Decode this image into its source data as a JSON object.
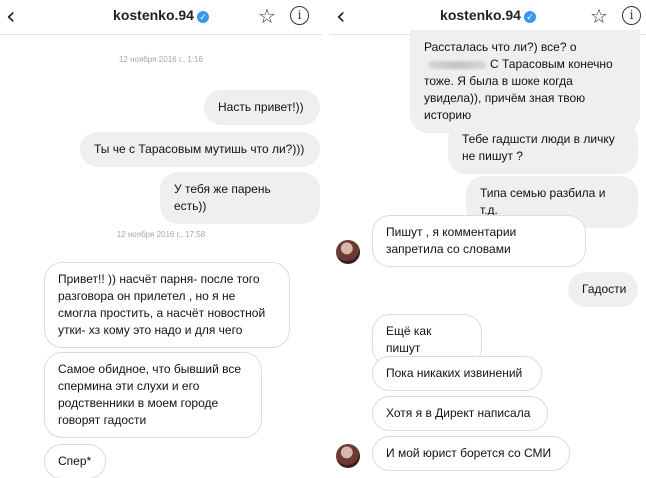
{
  "username": "kostenko.94",
  "icons": {
    "back": "chevron-left-icon",
    "verified": "verified-badge-icon",
    "star": "star-icon",
    "info": "info-icon"
  },
  "colors": {
    "verified": "#3897f0",
    "outgoing_bubble": "#efefef",
    "incoming_border": "#dcdcdc"
  },
  "left": {
    "ts1": "12 ноября 2016 г., 1:16",
    "m1": "Насть привет!))",
    "m2": "Ты че с Тарасовым мутишь что ли?)))",
    "m3": "У тебя же парень есть))",
    "ts2": "12 ноября 2016 г., 17:58",
    "r1": "Привет!! )) насчёт парня- после того разговора он прилетел , но я не смогла простить, а насчёт новостной утки- хз кому это надо и для чего",
    "r2": "Самое обидное, что бывший все спермина эти слухи и его родственники в моем городе говорят гадости",
    "r3": "Спер*"
  },
  "right": {
    "m0a": "Рассталась что ли?) все? о",
    "m0b": "С Тарасовым конечно тоже. Я была в шоке когда увидела)), причём зная твою историю",
    "m1": "Тебе гадшсти люди в личку не пишут ?",
    "m2": "Типа семью разбила и т.д.",
    "r1": "Пишут , я комментарии запретила со словами",
    "m3": "Гадости",
    "r2": "Ещё как пишут",
    "r3": "Пока никаких извинений",
    "r4": "Хотя я в Директ написала",
    "r5": "И мой юрист борется со СМИ"
  }
}
